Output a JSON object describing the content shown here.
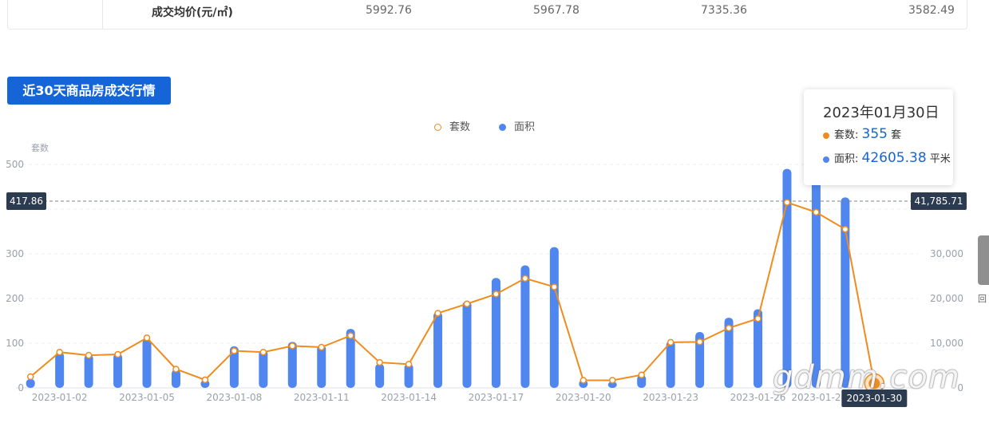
{
  "table": {
    "row_label": "成交均价(元/㎡)",
    "values": [
      "5992.76",
      "5967.78",
      "7335.36",
      "3582.49"
    ]
  },
  "section_title": "近30天商品房成交行情",
  "tooltip": {
    "date": "2023年01月30日",
    "units_label": "套数:",
    "units_value": "355",
    "units_unit": "套",
    "area_label": "面积:",
    "area_value": "42605.38",
    "area_unit": "平米"
  },
  "side_button_label": "回",
  "watermark": "gdmm.com",
  "colors": {
    "line": "#f08c1e",
    "bar": "#4f86ef",
    "tag": "#1565d8",
    "axis_label_bg": "#2d3b50"
  },
  "chart_data": {
    "type": "bar",
    "legend": [
      {
        "name": "套数",
        "type": "line",
        "icon": "hollow-circle"
      },
      {
        "name": "面积",
        "type": "bar",
        "icon": "filled-circle"
      }
    ],
    "legend_position": "top-center",
    "y_left": {
      "name": "套数",
      "min": 0,
      "max": 500,
      "ticks": [
        "0",
        "100",
        "200",
        "300",
        "500"
      ]
    },
    "y_right": {
      "min": 0,
      "max": 50000,
      "ticks": [
        "0",
        "10,000",
        "20,000",
        "30,000"
      ]
    },
    "grid": true,
    "crosshair": {
      "left_value": "417.86",
      "right_value": "41,785.71",
      "x_label": "2023-01-30"
    },
    "x_tick_labels": [
      "2023-01-02",
      "2023-01-05",
      "2023-01-08",
      "2023-01-11",
      "2023-01-14",
      "2023-01-17",
      "2023-01-20",
      "2023-01-23",
      "2023-01-26"
    ],
    "x_tick_labels_partial": [
      "2023-01-2"
    ],
    "x": [
      "2023-01-01",
      "2023-01-02",
      "2023-01-03",
      "2023-01-04",
      "2023-01-05",
      "2023-01-06",
      "2023-01-07",
      "2023-01-08",
      "2023-01-09",
      "2023-01-10",
      "2023-01-11",
      "2023-01-12",
      "2023-01-13",
      "2023-01-14",
      "2023-01-15",
      "2023-01-16",
      "2023-01-17",
      "2023-01-18",
      "2023-01-19",
      "2023-01-20",
      "2023-01-21",
      "2023-01-22",
      "2023-01-23",
      "2023-01-24",
      "2023-01-25",
      "2023-01-26",
      "2023-01-27",
      "2023-01-28",
      "2023-01-29",
      "2023-01-30",
      "2023-01-31"
    ],
    "series": [
      {
        "name": "套数",
        "type": "line",
        "axis": "left",
        "values": [
          25,
          80,
          73,
          75,
          112,
          42,
          18,
          83,
          80,
          94,
          91,
          117,
          57,
          53,
          167,
          188,
          210,
          245,
          226,
          17,
          17,
          29,
          102,
          103,
          134,
          155,
          415,
          393,
          355,
          10
        ]
      },
      {
        "name": "面积",
        "type": "bar",
        "axis": "right",
        "values": [
          2000,
          8000,
          7500,
          7700,
          11000,
          4100,
          1800,
          9300,
          8500,
          10300,
          9600,
          13200,
          5400,
          5400,
          17000,
          19400,
          24600,
          27400,
          31500,
          1800,
          1400,
          2900,
          10500,
          12500,
          15700,
          17600,
          49000,
          48000,
          42605.38,
          300
        ]
      }
    ]
  }
}
